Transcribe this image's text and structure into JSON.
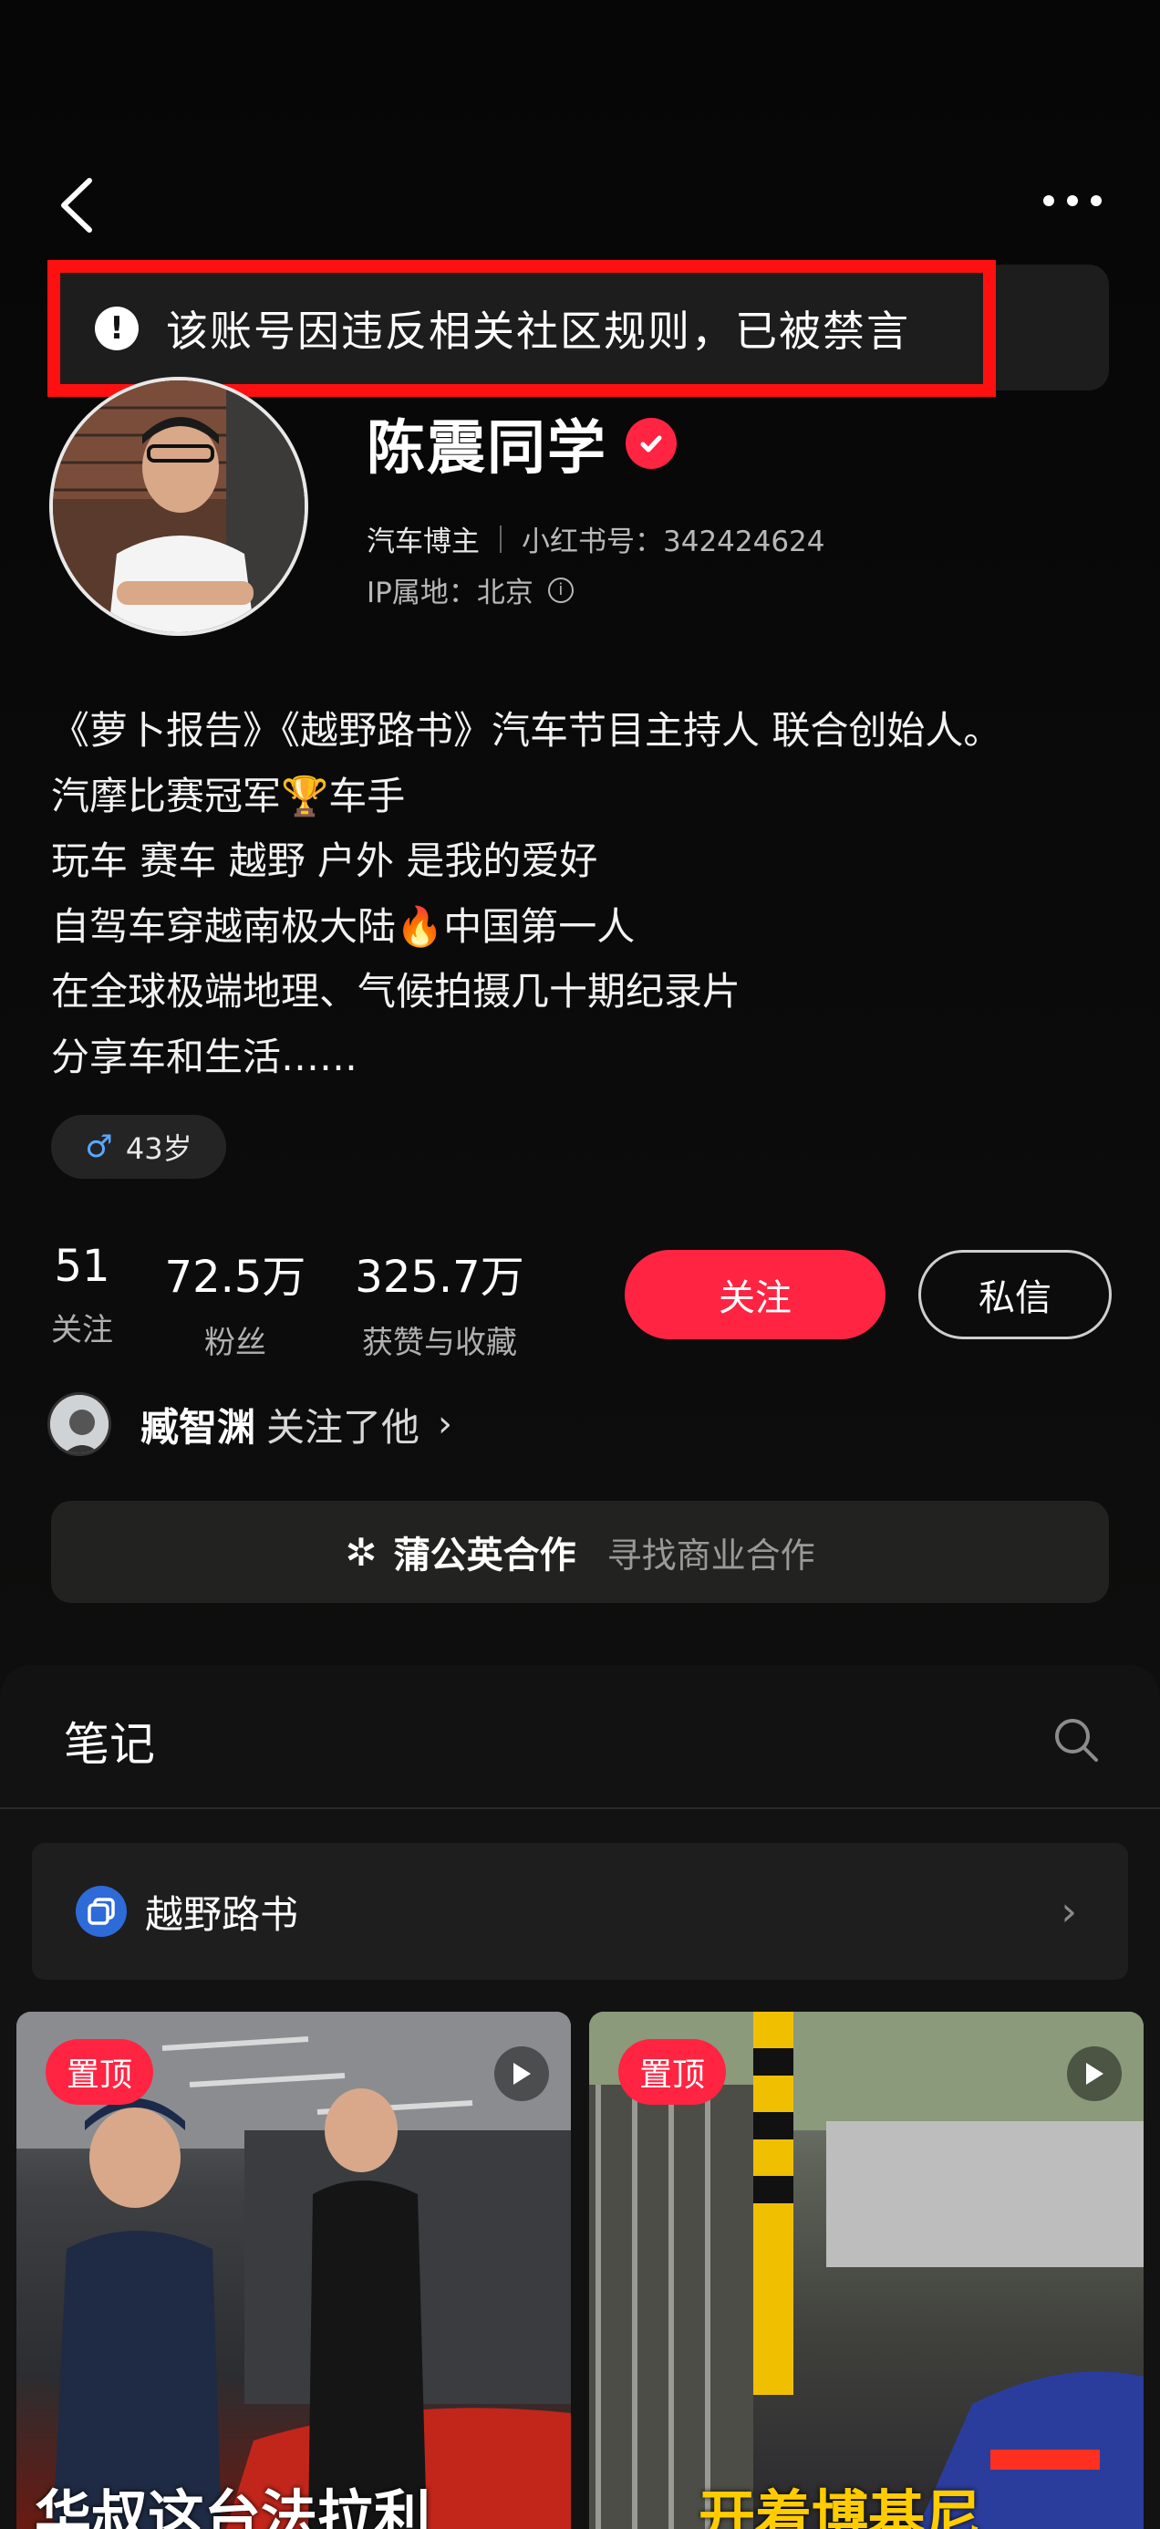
{
  "ban_notice": "该账号因违反相关社区规则，已被禁言",
  "profile": {
    "name": "陈震同学",
    "role": "汽车博主",
    "account_id": "小红书号：342424624",
    "ip_location": "IP属地：北京"
  },
  "bio_lines": [
    "《萝卜报告》《越野路书》汽车节目主持人 联合创始人。",
    "汽摩比赛冠军🏆车手",
    "玩车 赛车 越野 户外 是我的爱好",
    "自驾车穿越南极大陆🔥中国第一人",
    "在全球极端地理、气候拍摄几十期纪录片",
    "分享车和生活……"
  ],
  "age_tag": "43岁",
  "stats": [
    {
      "value": "51",
      "label": "关注"
    },
    {
      "value": "72.5万",
      "label": "粉丝"
    },
    {
      "value": "325.7万",
      "label": "获赞与收藏"
    }
  ],
  "buttons": {
    "follow": "关注",
    "message": "私信"
  },
  "mutual": {
    "name": "臧智渊",
    "text": "关注了他",
    "chevron": "›"
  },
  "cooperation": {
    "title": "蒲公英合作",
    "subtitle": "寻找商业合作"
  },
  "notes": {
    "tab_title": "笔记",
    "collection": "越野路书",
    "cards": [
      {
        "badge": "置顶",
        "caption": "华叔这台法拉利"
      },
      {
        "badge": "置顶",
        "caption": "开着博基尼"
      }
    ]
  },
  "colors": {
    "accent": "#ff2442",
    "ban_border": "#ff1010",
    "background": "#0b0b0b"
  }
}
